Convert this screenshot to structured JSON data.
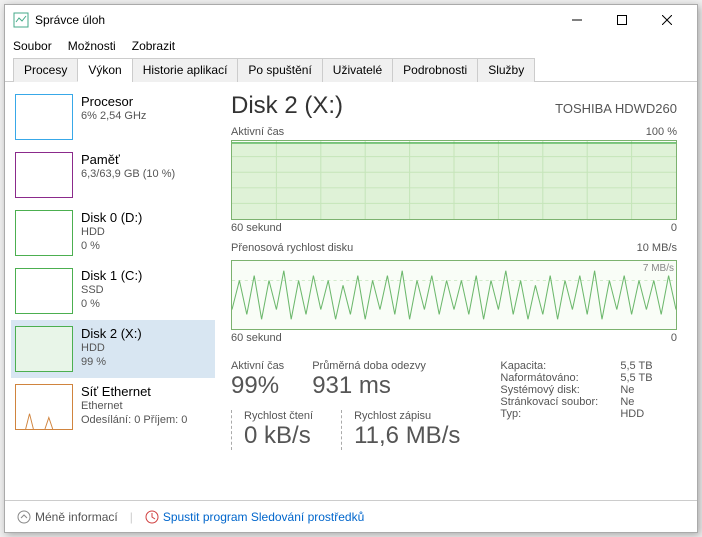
{
  "window": {
    "title": "Správce úloh"
  },
  "menu": {
    "file": "Soubor",
    "options": "Možnosti",
    "view": "Zobrazit"
  },
  "tabs": {
    "procesy": "Procesy",
    "vykon": "Výkon",
    "historie": "Historie aplikací",
    "spusteni": "Po spuštění",
    "uzivatele": "Uživatelé",
    "podrobnosti": "Podrobnosti",
    "sluzby": "Služby"
  },
  "sidebar": {
    "cpu": {
      "name": "Procesor",
      "sub": "6% 2,54 GHz"
    },
    "mem": {
      "name": "Paměť",
      "sub": "6,3/63,9 GB (10 %)"
    },
    "disk0": {
      "name": "Disk 0 (D:)",
      "sub1": "HDD",
      "sub2": "0 %"
    },
    "disk1": {
      "name": "Disk 1 (C:)",
      "sub1": "SSD",
      "sub2": "0 %"
    },
    "disk2": {
      "name": "Disk 2 (X:)",
      "sub1": "HDD",
      "sub2": "99 %"
    },
    "net": {
      "name": "Síť Ethernet",
      "sub1": "Ethernet",
      "sub2": "Odesílání: 0 Příjem: 0"
    }
  },
  "detail": {
    "title": "Disk 2 (X:)",
    "model": "TOSHIBA HDWD260",
    "chart1": {
      "label": "Aktivní čas",
      "max": "100 %",
      "xleft": "60 sekund",
      "xright": "0"
    },
    "chart2": {
      "label": "Přenosová rychlost disku",
      "max": "10 MB/s",
      "marker": "7 MB/s",
      "xleft": "60 sekund",
      "xright": "0"
    },
    "stats": {
      "active_label": "Aktivní čas",
      "active_val": "99%",
      "resp_label": "Průměrná doba odezvy",
      "resp_val": "931 ms",
      "read_label": "Rychlost čtení",
      "read_val": "0 kB/s",
      "write_label": "Rychlost zápisu",
      "write_val": "11,6 MB/s",
      "cap_label": "Kapacita:",
      "cap_val": "5,5 TB",
      "fmt_label": "Naformátováno:",
      "fmt_val": "5,5 TB",
      "sys_label": "Systémový disk:",
      "sys_val": "Ne",
      "page_label": "Stránkovací soubor:",
      "page_val": "Ne",
      "type_label": "Typ:",
      "type_val": "HDD"
    }
  },
  "footer": {
    "less": "Méně informací",
    "resmon": "Spustit program Sledování prostředků"
  },
  "chart_data": {
    "type": "line",
    "title": "Disk 2 (X:) activity",
    "series": [
      {
        "name": "Aktivní čas (%)",
        "ylim": [
          0,
          100
        ],
        "values": [
          99,
          99,
          99,
          99,
          99,
          99,
          99,
          99,
          99,
          99,
          99,
          99,
          99,
          99,
          99,
          99,
          99,
          99,
          99,
          99,
          99,
          99,
          99,
          99,
          99,
          99,
          99,
          99,
          99,
          99
        ]
      },
      {
        "name": "Přenosová rychlost disku (MB/s)",
        "ylim": [
          0,
          10
        ],
        "values": [
          3,
          7,
          2,
          8,
          1,
          7,
          3,
          9,
          1,
          7,
          2,
          8,
          3,
          7,
          1,
          6,
          2,
          8,
          1,
          7,
          3,
          8,
          2,
          9,
          1,
          7,
          3,
          8,
          2,
          7
        ]
      }
    ],
    "x_label": "60 sekund → 0"
  }
}
